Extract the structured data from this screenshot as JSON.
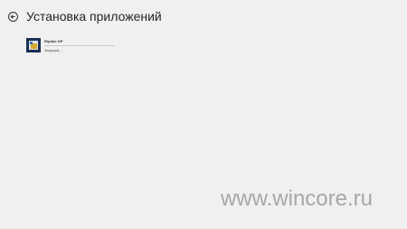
{
  "header": {
    "title": "Установка приложений",
    "back_icon": "back-arrow-circle-icon"
  },
  "apps": [
    {
      "name": "Riptide GP",
      "status": "Загрузка…",
      "progress": 0.0,
      "tile_color": "#1b2f52"
    }
  ],
  "watermark": {
    "text": "www.wincore.ru"
  },
  "colors": {
    "background": "#f0f0f0",
    "text": "#262626",
    "watermark": "#a7a7a7"
  }
}
